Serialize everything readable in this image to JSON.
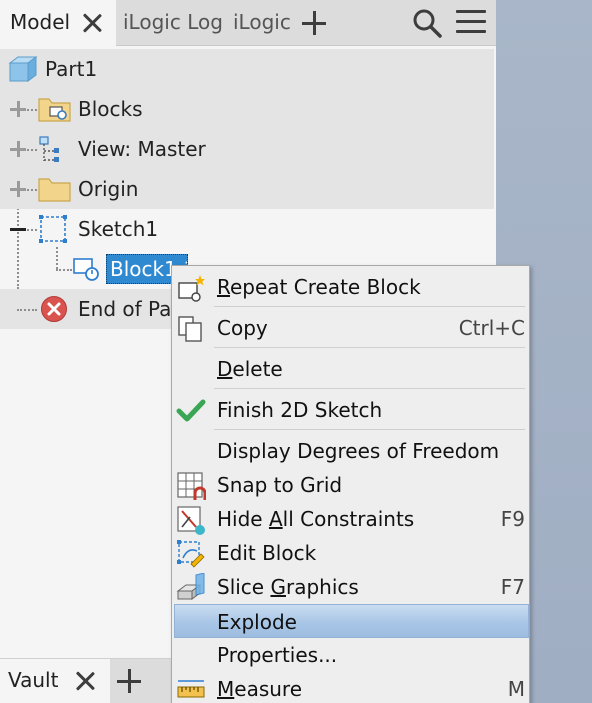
{
  "tabs": {
    "model_label": "Model",
    "ilogic_log_label": "iLogic Log",
    "ilogic_label": "iLogic"
  },
  "tree": {
    "root": "Part1",
    "items": [
      {
        "label": "Blocks",
        "icon": "folder-blocks-icon"
      },
      {
        "label": "View: Master",
        "icon": "view-icon"
      },
      {
        "label": "Origin",
        "icon": "folder-icon"
      },
      {
        "label": "Sketch1",
        "icon": "sketch-icon"
      },
      {
        "label": "Block1:1",
        "icon": "block-instance-icon"
      },
      {
        "label": "End of Part",
        "icon": "end-of-part-icon"
      }
    ]
  },
  "vault": {
    "tab_label": "Vault"
  },
  "context_menu": {
    "items": [
      {
        "label": "Repeat Create Block",
        "underline": "R",
        "shortcut": "",
        "icon": "create-block-icon"
      },
      {
        "label": "Copy",
        "underline": "",
        "shortcut": "Ctrl+C",
        "icon": "copy-icon"
      },
      {
        "label": "Delete",
        "underline": "D",
        "shortcut": "",
        "icon": ""
      },
      {
        "label": "Finish 2D Sketch",
        "underline": "",
        "shortcut": "",
        "icon": "checkmark-icon"
      },
      {
        "label": "Display Degrees of Freedom",
        "underline": "",
        "shortcut": "",
        "icon": ""
      },
      {
        "label": "Snap to Grid",
        "underline": "",
        "shortcut": "",
        "icon": "snap-grid-icon"
      },
      {
        "label": "Hide All Constraints",
        "underline": "A",
        "shortcut": "F9",
        "icon": "hide-constraints-icon"
      },
      {
        "label": "Edit Block",
        "underline": "",
        "shortcut": "",
        "icon": "edit-block-icon"
      },
      {
        "label": "Slice Graphics",
        "underline": "G",
        "shortcut": "F7",
        "icon": "slice-graphics-icon"
      },
      {
        "label": "Explode",
        "underline": "",
        "shortcut": "",
        "icon": "",
        "highlighted": true
      },
      {
        "label": "Properties...",
        "underline": "",
        "shortcut": "",
        "icon": ""
      },
      {
        "label": "Measure",
        "underline": "M",
        "shortcut": "M",
        "icon": "measure-icon"
      }
    ]
  },
  "colors": {
    "selection": "#2f89d0",
    "menu_highlight": "#a9c6e6",
    "check_green": "#3aa655",
    "error_red": "#d9534f",
    "folder_yellow": "#f2d48a"
  }
}
